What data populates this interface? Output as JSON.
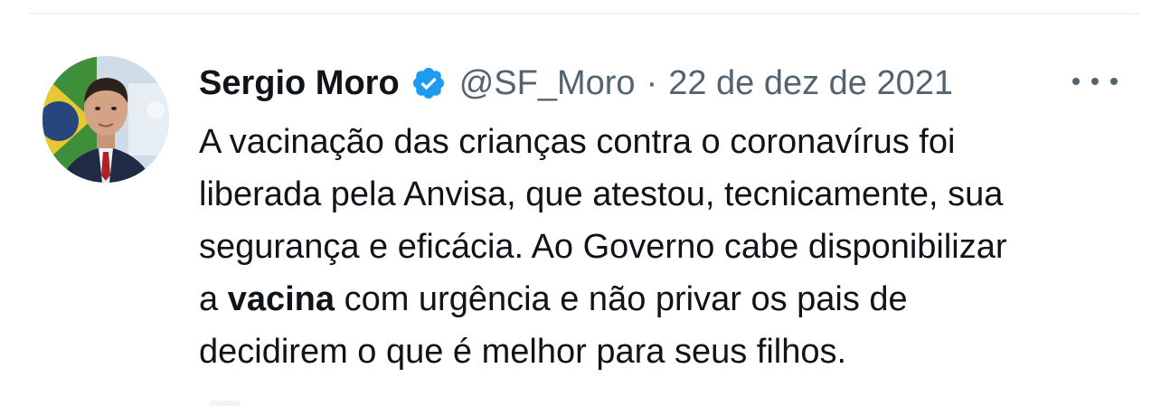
{
  "tweet": {
    "author": {
      "display_name": "Sergio Moro",
      "verified": true,
      "verified_icon": "verified-badge-icon",
      "handle": "@SF_Moro",
      "avatar": "avatar-photo"
    },
    "separator": "·",
    "date": "22 de dez de 2021",
    "more_icon": "more-options-icon",
    "text_lines": [
      "A vacinação das crianças contra o coronavírus foi",
      "liberada pela Anvisa, que atestou, tecnicamente, sua",
      "segurança e eficácia. Ao Governo cabe disponibilizar"
    ],
    "line4_prefix": "a ",
    "line4_bold": "vacina",
    "line4_suffix": " com urgência e não privar os pais de",
    "line5": "decidirem o que é melhor para seus filhos."
  },
  "colors": {
    "text_primary": "#0f1419",
    "text_secondary": "#536471",
    "verified_blue": "#1d9bf0",
    "background": "#ffffff"
  }
}
